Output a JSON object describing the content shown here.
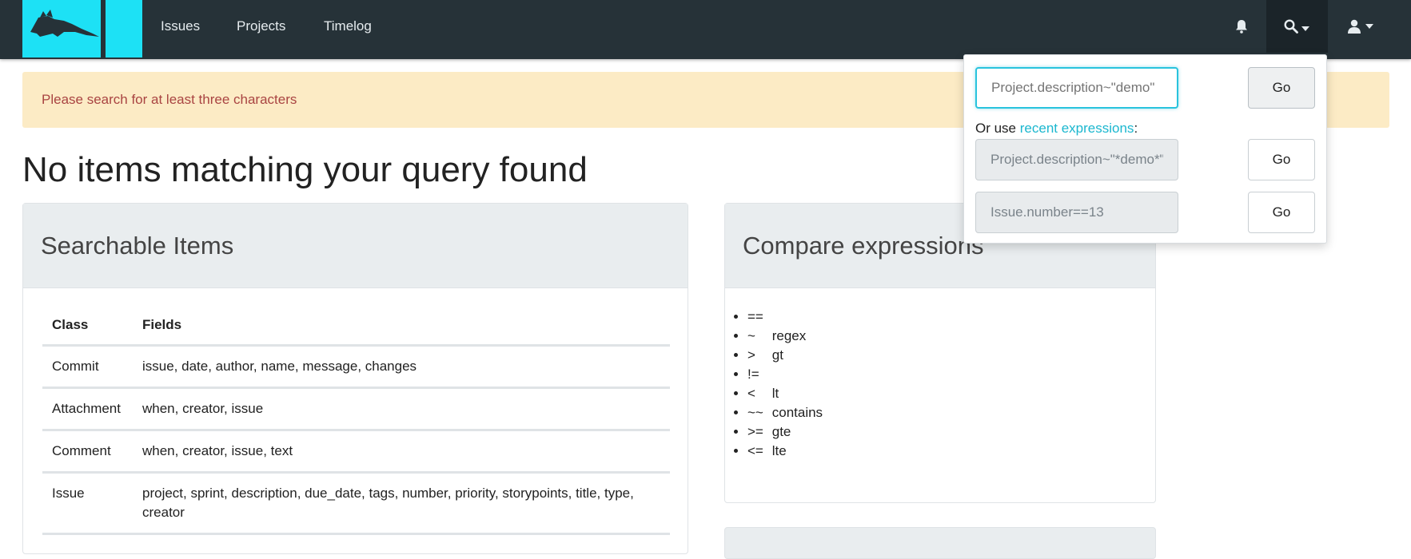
{
  "nav": {
    "items": [
      {
        "label": "Issues"
      },
      {
        "label": "Projects"
      },
      {
        "label": "Timelog"
      }
    ],
    "icons": {
      "notification": "bell-icon",
      "search": "search-icon",
      "user": "user-icon",
      "caret": "caret-down-icon"
    },
    "colors": {
      "navbar": "#263238",
      "brand": "#1de1f5",
      "accent": "#29c3dd"
    }
  },
  "alert": {
    "message": "Please search for at least three characters"
  },
  "page_title": "No items matching your query found",
  "searchable": {
    "title": "Searchable Items",
    "columns": [
      "Class",
      "Fields"
    ],
    "rows": [
      {
        "class": "Commit",
        "fields": "issue, date, author, name, message, changes"
      },
      {
        "class": "Attachment",
        "fields": "when, creator, issue"
      },
      {
        "class": "Comment",
        "fields": "when, creator, issue, text"
      },
      {
        "class": "Issue",
        "fields": "project, sprint, description, due_date, tags, number, priority, storypoints, title, type, creator"
      }
    ]
  },
  "compare": {
    "title": "Compare expressions",
    "operators": [
      {
        "symbol": "==",
        "name": ""
      },
      {
        "symbol": "~",
        "name": "regex"
      },
      {
        "symbol": ">",
        "name": "gt"
      },
      {
        "symbol": "!=",
        "name": ""
      },
      {
        "symbol": "<",
        "name": "lt"
      },
      {
        "symbol": "~~",
        "name": "contains"
      },
      {
        "symbol": ">=",
        "name": "gte"
      },
      {
        "symbol": "<=",
        "name": "lte"
      }
    ]
  },
  "search_dropdown": {
    "input_placeholder": "Project.description~\"demo\"",
    "go_label": "Go",
    "hint_prefix": "Or use ",
    "hint_link": "recent expressions",
    "hint_suffix": ":",
    "recent": [
      {
        "value": "Project.description~\"*demo*\"",
        "go_label": "Go"
      },
      {
        "value": "Issue.number==13",
        "go_label": "Go"
      }
    ]
  }
}
